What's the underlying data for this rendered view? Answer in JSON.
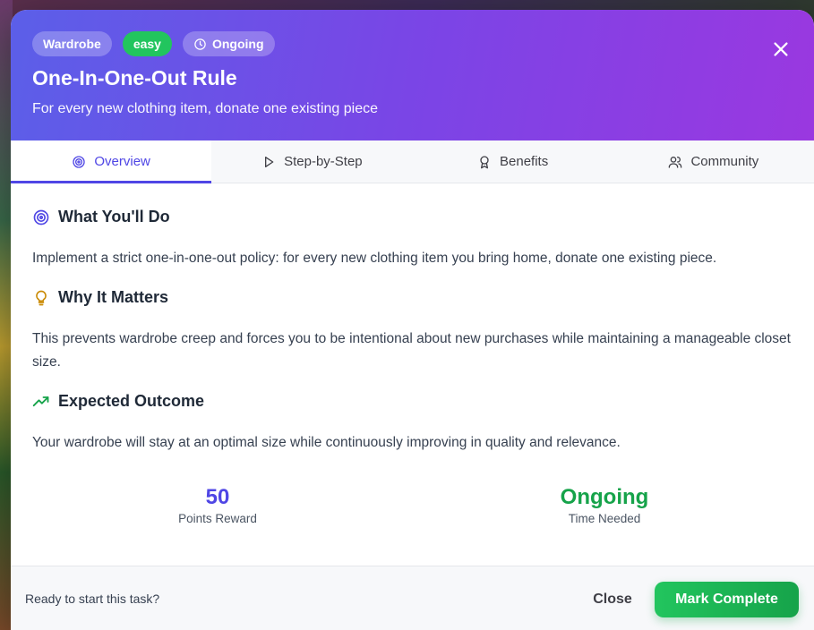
{
  "header": {
    "badges": {
      "category": "Wardrobe",
      "difficulty": "easy",
      "time": "Ongoing"
    },
    "title": "One-In-One-Out Rule",
    "subtitle": "For every new clothing item, donate one existing piece",
    "close_icon": "close-icon"
  },
  "tabs": [
    {
      "label": "Overview",
      "icon": "target-icon",
      "active": true
    },
    {
      "label": "Step-by-Step",
      "icon": "play-icon",
      "active": false
    },
    {
      "label": "Benefits",
      "icon": "award-icon",
      "active": false
    },
    {
      "label": "Community",
      "icon": "users-icon",
      "active": false
    }
  ],
  "overview": {
    "what": {
      "heading": "What You'll Do",
      "text": "Implement a strict one-in-one-out policy: for every new clothing item you bring home, donate one existing piece."
    },
    "why": {
      "heading": "Why It Matters",
      "text": "This prevents wardrobe creep and forces you to be intentional about new purchases while maintaining a manageable closet size."
    },
    "outcome": {
      "heading": "Expected Outcome",
      "text": "Your wardrobe will stay at an optimal size while continuously improving in quality and relevance."
    }
  },
  "stats": {
    "points": {
      "value": "50",
      "label": "Points Reward"
    },
    "time": {
      "value": "Ongoing",
      "label": "Time Needed"
    }
  },
  "footer": {
    "prompt": "Ready to start this task?",
    "close_label": "Close",
    "complete_label": "Mark Complete"
  },
  "colors": {
    "accent": "#4f46e5",
    "success": "#16a34a",
    "header_gradient_start": "#5b5fe8",
    "header_gradient_end": "#9a38e0"
  }
}
